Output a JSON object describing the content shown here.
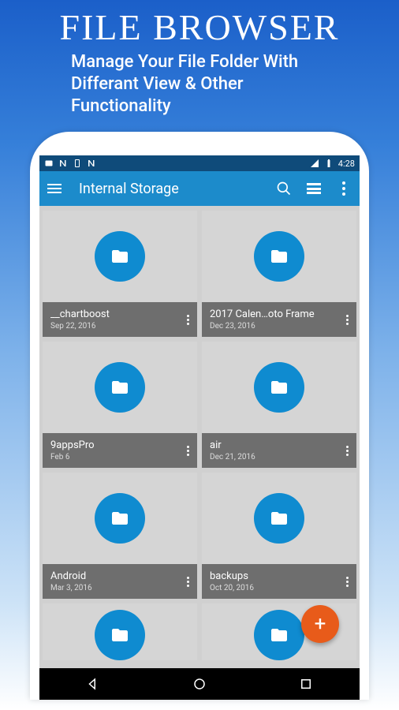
{
  "promo": {
    "title": "FILE BROWSER",
    "subtitle": "Manage Your File Folder With\nDifferant View & Other\nFunctionality"
  },
  "status": {
    "time": "4:28"
  },
  "appbar": {
    "title": "Internal Storage"
  },
  "folders": [
    {
      "name": "__chartboost",
      "date": "Sep 22, 2016"
    },
    {
      "name": "2017 Calen…oto Frame",
      "date": "Dec 23, 2016"
    },
    {
      "name": "9appsPro",
      "date": "Feb 6"
    },
    {
      "name": "air",
      "date": "Dec 21, 2016"
    },
    {
      "name": "Android",
      "date": "Mar 3, 2016"
    },
    {
      "name": "backups",
      "date": "Oct 20, 2016"
    }
  ],
  "fab": {
    "label": "+"
  }
}
